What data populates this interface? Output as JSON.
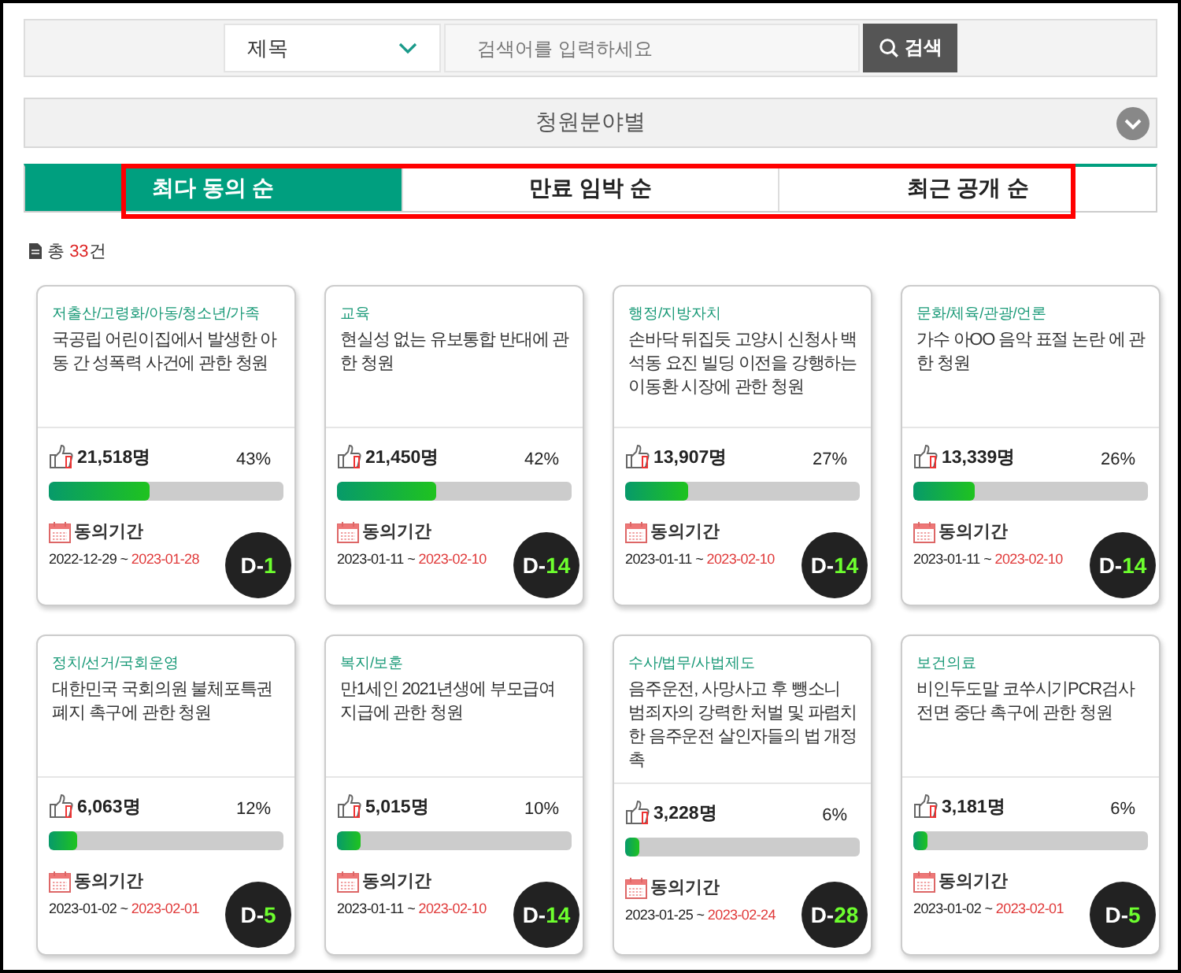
{
  "search": {
    "field_select": "제목",
    "placeholder": "검색어를 입력하세요",
    "button": "검색"
  },
  "category_filter": {
    "label": "청원분야별"
  },
  "tabs": [
    {
      "label": "최다 동의 순",
      "selected": true
    },
    {
      "label": "만료 임박 순",
      "selected": false
    },
    {
      "label": "최근 공개 순",
      "selected": false
    }
  ],
  "total": {
    "prefix": "총 ",
    "count": "33",
    "suffix": "건"
  },
  "petitions": [
    {
      "category": "저출산/고령화/아동/청소년/가족",
      "title": "국공립 어린이집에서 발생한 아동 간 성폭력 사건에 관한 청원",
      "agree_count": "21,518명",
      "percent": "43%",
      "level": 0.43,
      "period_label": "동의기간",
      "start": "2022-12-29 ~",
      "end": "2023-01-28",
      "d_prefix": "D-",
      "d_number": "1"
    },
    {
      "category": "교육",
      "title": "현실성 없는 유보통합 반대에 관한 청원",
      "agree_count": "21,450명",
      "percent": "42%",
      "level": 0.42,
      "period_label": "동의기간",
      "start": "2023-01-11 ~",
      "end": "2023-02-10",
      "d_prefix": "D-",
      "d_number": "14"
    },
    {
      "category": "행정/지방자치",
      "title": "손바닥 뒤집듯 고양시 신청사 백석동 요진 빌딩 이전을 강행하는 이동환 시장에 관한 청원",
      "agree_count": "13,907명",
      "percent": "27%",
      "level": 0.27,
      "period_label": "동의기간",
      "start": "2023-01-11 ~",
      "end": "2023-02-10",
      "d_prefix": "D-",
      "d_number": "14"
    },
    {
      "category": "문화/체육/관광/언론",
      "title": "가수 아OO 음악 표절 논란 에 관한 청원",
      "agree_count": "13,339명",
      "percent": "26%",
      "level": 0.26,
      "period_label": "동의기간",
      "start": "2023-01-11 ~",
      "end": "2023-02-10",
      "d_prefix": "D-",
      "d_number": "14"
    },
    {
      "category": "정치/선거/국회운영",
      "title": "대한민국 국회의원 불체포특권 폐지 촉구에 관한 청원",
      "agree_count": "6,063명",
      "percent": "12%",
      "level": 0.12,
      "period_label": "동의기간",
      "start": "2023-01-02 ~",
      "end": "2023-02-01",
      "d_prefix": "D-",
      "d_number": "5"
    },
    {
      "category": "복지/보훈",
      "title": "만1세인 2021년생에 부모급여 지급에 관한 청원",
      "agree_count": "5,015명",
      "percent": "10%",
      "level": 0.1,
      "period_label": "동의기간",
      "start": "2023-01-11 ~",
      "end": "2023-02-10",
      "d_prefix": "D-",
      "d_number": "14"
    },
    {
      "category": "수사/법무/사법제도",
      "title": "음주운전, 사망사고 후 뺑소니 범죄자의 강력한 처벌 및 파렴치한 음주운전 살인자들의 법 개정 촉",
      "agree_count": "3,228명",
      "percent": "6%",
      "level": 0.06,
      "period_label": "동의기간",
      "start": "2023-01-25 ~",
      "end": "2023-02-24",
      "d_prefix": "D-",
      "d_number": "28"
    },
    {
      "category": "보건의료",
      "title": "비인두도말 코쑤시기PCR검사 전면 중단 촉구에 관한 청원",
      "agree_count": "3,181명",
      "percent": "6%",
      "level": 0.06,
      "period_label": "동의기간",
      "start": "2023-01-02 ~",
      "end": "2023-02-01",
      "d_prefix": "D-",
      "d_number": "5"
    }
  ]
}
